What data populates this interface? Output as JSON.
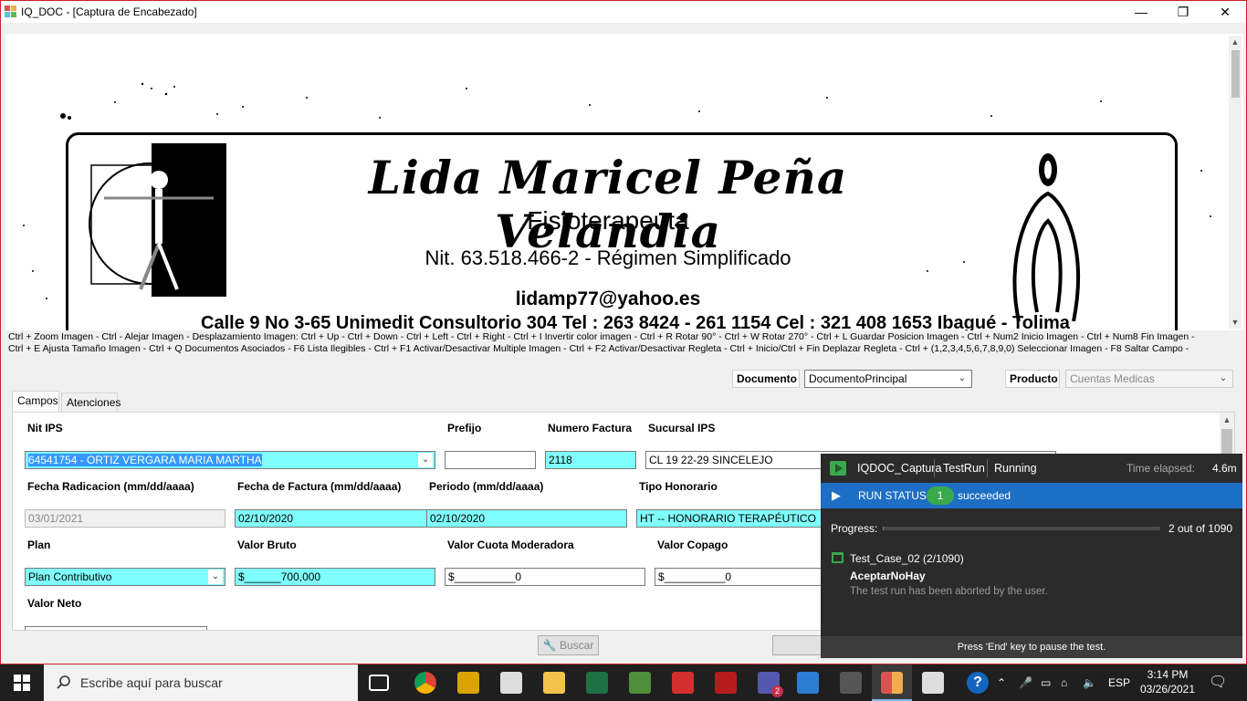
{
  "window": {
    "title": "IQ_DOC - [Captura de Encabezado]",
    "minimize_glyph": "—",
    "restore_glyph": "❐",
    "close_glyph": "✕"
  },
  "document_image": {
    "name": "Lida Maricel Peña Velandia",
    "role": "Fisioterapeuta",
    "nit": "Nit. 63.518.466-2  -  Régimen Simplificado",
    "email": "lidamp77@yahoo.es",
    "address": "Calle 9 No 3-65 Unimedit Consultorio 304 Tel : 263 8424 - 261 1154 Cel : 321 408 1653 Ibagué - Tolima"
  },
  "help_lines": [
    "Ctrl + Zoom Imagen - Ctrl - Alejar Imagen    - Desplazamiento Imagen: Ctrl + Up - Ctrl + Down - Ctrl + Left - Ctrl + Right    - Ctrl + I Invertir color imagen - Ctrl + R Rotar 90° - Ctrl + W Rotar 270°    - Ctrl + L Guardar Posicion Imagen    - Ctrl + Num2 Inicio Imagen - Ctrl + Num8 Fin Imagen -",
    "Ctrl + E Ajusta Tamaño Imagen    - Ctrl + Q Documentos Asociados - F6 Lista Ilegibles    - Ctrl + F1 Activar/Desactivar Multiple Imagen - Ctrl + F2 Activar/Desactivar Regleta    - Ctrl + Inicio/Ctrl + Fin Deplazar Regleta    - Ctrl + (1,2,3,4,5,6,7,8,9,0) Seleccionar Imagen    - F8 Saltar Campo -"
  ],
  "header_form": {
    "documento_label": "Documento",
    "documento_value": "DocumentoPrincipal",
    "producto_label": "Producto",
    "producto_value": "Cuentas Medicas"
  },
  "tabs": [
    "Campos",
    "Atenciones"
  ],
  "fields": {
    "nit_ips_label": "Nit IPS",
    "nit_ips_value": "64541754 - ORTIZ VERGARA MARIA MARTHA",
    "prefijo_label": "Prefijo",
    "prefijo_value": "",
    "numero_factura_label": "Numero Factura",
    "numero_factura_value": "2118",
    "sucursal_label": "Sucursal IPS",
    "sucursal_value": "CL 19 22-29  SINCELEJO",
    "fecha_radicacion_label": "Fecha Radicacion (mm/dd/aaaa)",
    "fecha_radicacion_value": "03/01/2021",
    "fecha_factura_label": "Fecha de Factura (mm/dd/aaaa)",
    "fecha_factura_value": "02/10/2020",
    "periodo_label": "Periodo (mm/dd/aaaa)",
    "periodo_value": "02/10/2020",
    "tipo_honorario_label": "Tipo Honorario",
    "tipo_honorario_value": "HT -- HONORARIO TERAPÉUTICO",
    "plan_label": "Plan",
    "plan_value": "Plan Contributivo",
    "valor_bruto_label": "Valor Bruto",
    "valor_bruto_value": "$______700,000",
    "cuota_moderadora_label": "Valor Cuota Moderadora",
    "cuota_moderadora_value": "$__________0",
    "copago_label": "Valor Copago",
    "copago_value": "$__________0",
    "valor_neto_label": "Valor Neto"
  },
  "buttons": {
    "buscar": "Buscar"
  },
  "test_runner": {
    "project": "IQDOC_Captura",
    "mode": "TestRun",
    "state": "Running",
    "time_label": "Time elapsed:",
    "time_value": "4.6m",
    "run_status_label": "RUN STATUS",
    "succeeded_count": "1",
    "succeeded_label": "succeeded",
    "progress_label": "Progress:",
    "progress_text": "2 out of 1090",
    "progress_fraction": 0.0018,
    "test_case": "Test_Case_02 (2/1090)",
    "step": "AceptarNoHay",
    "message": "The test run has been aborted by the user.",
    "footer": "Press 'End' key to pause the test.",
    "accent": "#1c6fc4",
    "success": "#3aa84e"
  },
  "taskbar": {
    "search_placeholder": "Escribe aquí para buscar",
    "language": "ESP",
    "time": "3:14 PM",
    "date": "03/26/2021",
    "teams_badge": "2"
  }
}
